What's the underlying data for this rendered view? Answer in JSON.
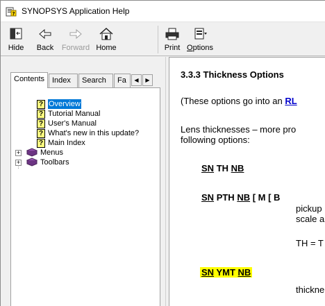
{
  "window": {
    "title": "SYNOPSYS Application Help"
  },
  "toolbar": {
    "hide": "Hide",
    "back": "Back",
    "forward": "Forward",
    "home": "Home",
    "print": "Print",
    "options": "Options"
  },
  "tabs": {
    "contents": "Contents",
    "index": "Index",
    "search": "Search",
    "favorites": "Fa"
  },
  "tree": {
    "items": [
      {
        "label": "Overview",
        "type": "topic",
        "selected": true
      },
      {
        "label": "Tutorial Manual",
        "type": "topic"
      },
      {
        "label": "User's Manual",
        "type": "topic"
      },
      {
        "label": "What's new in this update?",
        "type": "topic"
      },
      {
        "label": "Main Index",
        "type": "topic"
      },
      {
        "label": "Menus",
        "type": "book"
      },
      {
        "label": "Toolbars",
        "type": "book"
      }
    ]
  },
  "content": {
    "heading": "3.3.3 Thickness Options",
    "intro_prefix": "(These options go into an ",
    "intro_link": "RL",
    "lens_line1": "Lens thicknesses – more pro",
    "lens_line2": "following options:",
    "opt1": {
      "sn": "SN",
      "th": "TH",
      "nb": "NB"
    },
    "opt2": {
      "sn": "SN",
      "pth": "PTH",
      "nb": "NB",
      "bracket": "[ M [ B"
    },
    "opt2_sub1": "pickup",
    "opt2_sub2": "scale a",
    "opt2_th": "TH = T",
    "opt3": {
      "sn": "SN",
      "ymt": "YMT",
      "nb": "NB"
    },
    "opt3_sub": "thickne"
  },
  "colors": {
    "selection": "#0078d7",
    "link": "#0000cc",
    "highlight": "#ffff00"
  }
}
